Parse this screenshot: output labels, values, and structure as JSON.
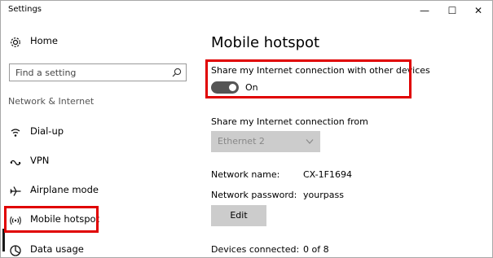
{
  "window": {
    "title": "Settings",
    "minimize_glyph": "—",
    "maximize_glyph": "☐",
    "close_glyph": "✕"
  },
  "sidebar": {
    "home_label": "Home",
    "search_placeholder": "Find a setting",
    "section_title": "Network & Internet",
    "items": [
      {
        "label": "Dial-up",
        "icon": "dialup-icon"
      },
      {
        "label": "VPN",
        "icon": "vpn-icon"
      },
      {
        "label": "Airplane mode",
        "icon": "airplane-icon"
      },
      {
        "label": "Mobile hotspot",
        "icon": "hotspot-icon",
        "selected": true
      },
      {
        "label": "Data usage",
        "icon": "data-usage-icon"
      }
    ]
  },
  "main": {
    "title": "Mobile hotspot",
    "share_label": "Share my Internet connection with other devices",
    "share_toggle_state": "On",
    "share_from_label": "Share my Internet connection from",
    "share_from_value": "Ethernet 2",
    "network_name_label": "Network name:",
    "network_name_value": "CX-1F1694",
    "network_password_label": "Network password:",
    "network_password_value": "yourpass",
    "edit_button_label": "Edit",
    "devices_connected_label": "Devices connected:",
    "devices_connected_value": "0 of 8"
  },
  "colors": {
    "highlight": "#e00000",
    "toggle_on": "#555555",
    "button_bg": "#cccccc"
  }
}
